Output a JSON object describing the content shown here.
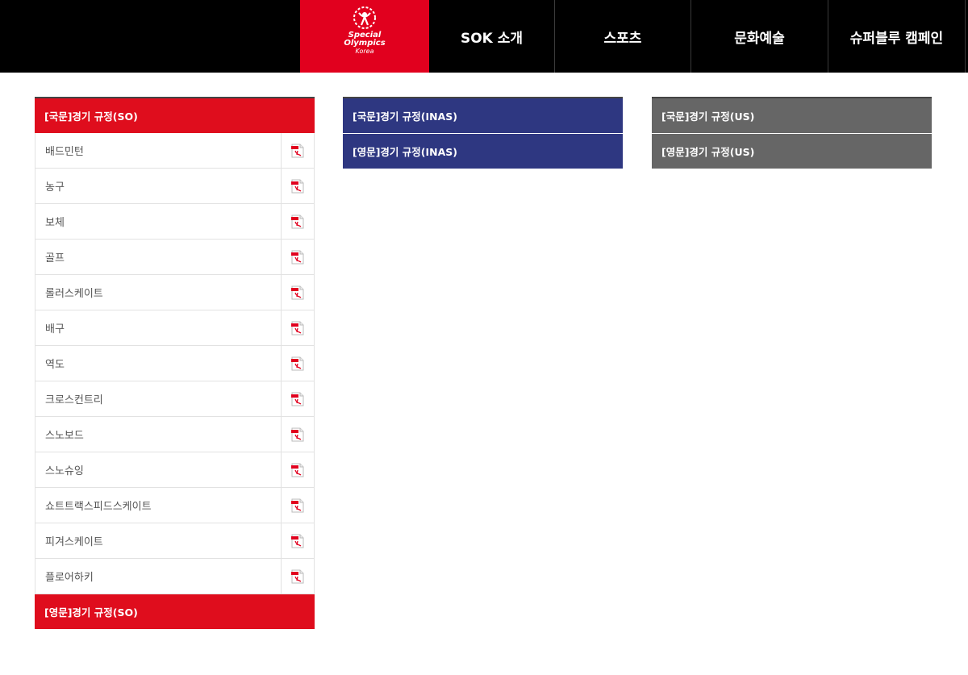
{
  "header": {
    "logo": {
      "line1": "Special",
      "line2": "Olympics",
      "line3": "Korea"
    },
    "nav": [
      "SOK 소개",
      "스포츠",
      "문화예술",
      "슈퍼블루 캠페인"
    ]
  },
  "panels": {
    "so": {
      "title": "[국문]경기 규정(SO)",
      "items": [
        "배드민턴",
        "농구",
        "보체",
        "골프",
        "롤러스케이트",
        "배구",
        "역도",
        "크로스컨트리",
        "스노보드",
        "스노슈잉",
        "쇼트트랙스피드스케이트",
        "피겨스케이트",
        "플로어하키"
      ],
      "footer": "[영문]경기 규정(SO)"
    },
    "inas": {
      "items": [
        "[국문]경기 규정(INAS)",
        "[영문]경기 규정(INAS)"
      ]
    },
    "us": {
      "items": [
        "[국문]경기 규정(US)",
        "[영문]경기 규정(US)"
      ]
    }
  },
  "icons": {
    "download": "pdf-file-icon"
  },
  "colors": {
    "brand_red": "#df0d1d",
    "inas_blue": "#2e3781",
    "us_gray": "#666666",
    "topbar": "#000000"
  }
}
